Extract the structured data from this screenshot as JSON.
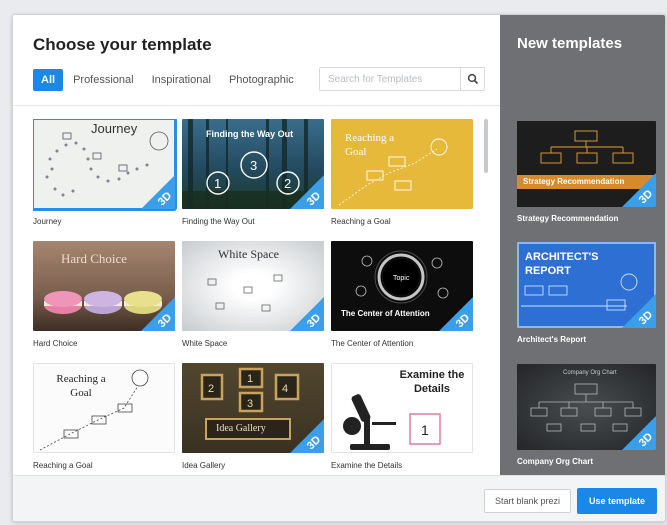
{
  "dialog": {
    "title": "Choose your template",
    "filters": [
      "All",
      "Professional",
      "Inspirational",
      "Photographic"
    ],
    "active_filter": "All",
    "search_placeholder": "Search for Templates",
    "badge": "3D"
  },
  "templates": [
    {
      "name": "Journey",
      "thumb_text": "Journey"
    },
    {
      "name": "Finding the Way Out",
      "thumb_text": "Finding the Way Out"
    },
    {
      "name": "Reaching a Goal",
      "thumb_text": "Reaching a Goal"
    },
    {
      "name": "Hard Choice",
      "thumb_text": "Hard Choice"
    },
    {
      "name": "White Space",
      "thumb_text": "White Space"
    },
    {
      "name": "The Center of Attention",
      "thumb_text": "The Center of Attention"
    },
    {
      "name": "Reaching a Goal",
      "thumb_text": "Reaching a Goal"
    },
    {
      "name": "Idea Gallery",
      "thumb_text": "Idea Gallery"
    },
    {
      "name": "Examine the Details",
      "thumb_text": "Examine the Details"
    }
  ],
  "new_templates": {
    "title": "New templates",
    "items": [
      {
        "name": "Strategy Recommendation",
        "thumb_text": "Strategy Recommendation"
      },
      {
        "name": "Architect's Report",
        "thumb_text": "ARCHITECT'S REPORT"
      },
      {
        "name": "Company Org Chart",
        "thumb_text": "Company Org Chart"
      }
    ]
  },
  "footer": {
    "start_blank_label": "Start blank prezi",
    "use_template_label": "Use template"
  },
  "colors": {
    "accent": "#1b87e6",
    "sidebar": "#6f7073"
  }
}
